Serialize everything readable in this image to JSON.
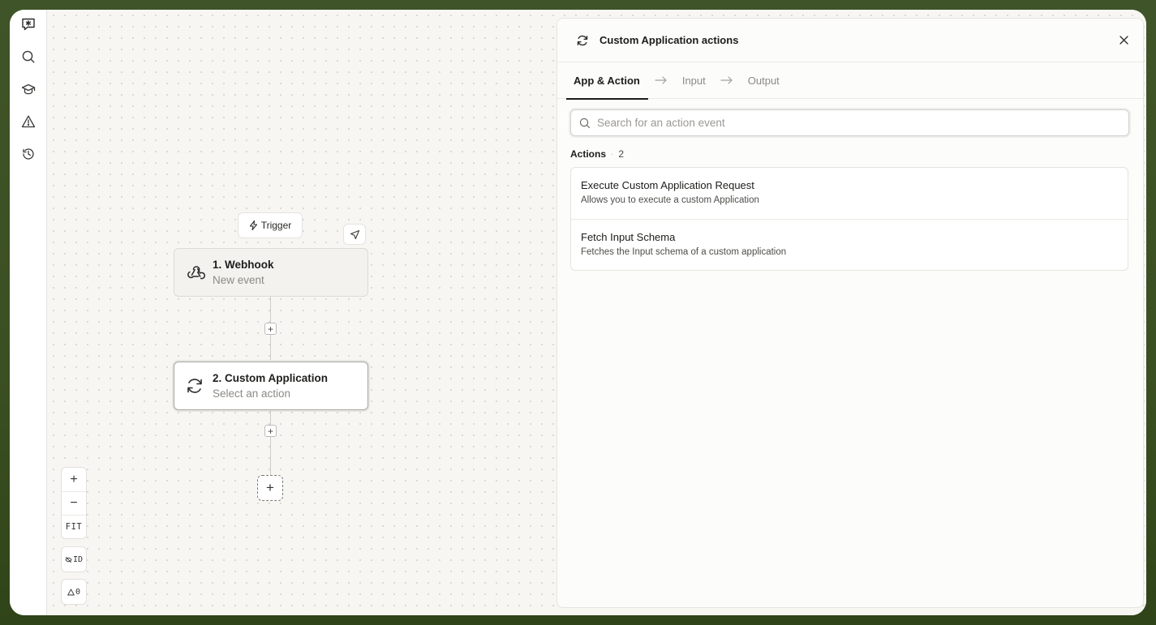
{
  "rail": {
    "items": [
      {
        "name": "logo-icon"
      },
      {
        "name": "search-icon"
      },
      {
        "name": "learn-icon"
      },
      {
        "name": "warning-icon"
      },
      {
        "name": "history-icon"
      }
    ]
  },
  "canvas": {
    "trigger_label": "Trigger",
    "nodes": [
      {
        "title": "1. Webhook",
        "subtitle": "New event"
      },
      {
        "title": "2. Custom Application",
        "subtitle": "Select an action"
      }
    ],
    "zoom": {
      "in": "+",
      "out": "−",
      "fit": "FIT"
    },
    "id_toggle": "ID",
    "warnings_count": "0"
  },
  "panel": {
    "title": "Custom Application actions",
    "steps": [
      "App & Action",
      "Input",
      "Output"
    ],
    "active_step": "App & Action",
    "search_placeholder": "Search for an action event",
    "actions_label": "Actions",
    "actions_count": "2",
    "actions": [
      {
        "title": "Execute Custom Application Request",
        "description": "Allows you to execute a custom Application"
      },
      {
        "title": "Fetch Input Schema",
        "description": "Fetches the Input schema of a custom application"
      }
    ]
  },
  "colors": {
    "outer_bg": "#3f5428",
    "canvas_bg": "#f7f6f3",
    "panel_bg": "#fcfcfb",
    "text_primary": "#1c1c1a",
    "text_muted": "#8c8a85"
  }
}
